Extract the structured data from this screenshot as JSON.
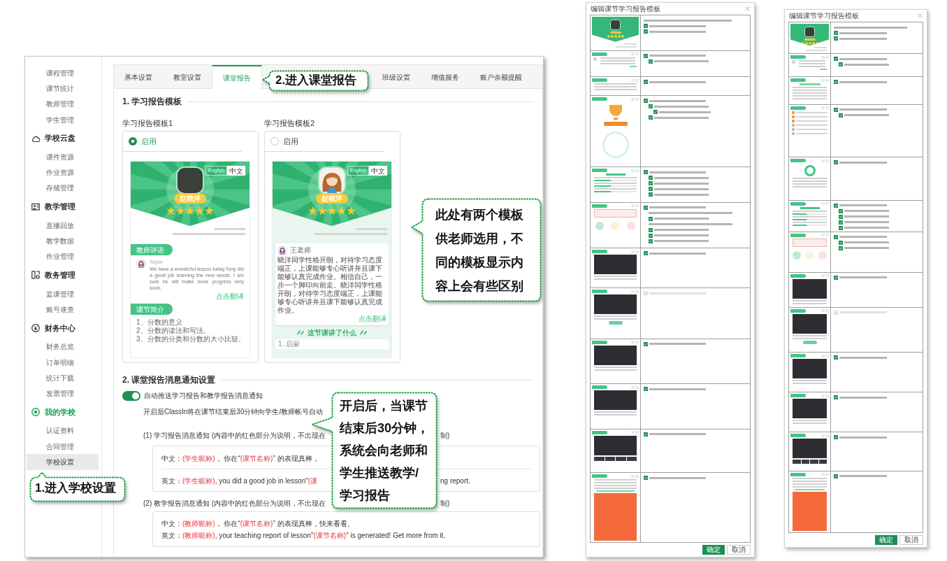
{
  "sidebar": {
    "groups": [
      {
        "items": [
          {
            "label": "课程管理",
            "selected": false
          },
          {
            "label": "课节统计",
            "selected": false
          },
          {
            "label": "教师管理",
            "selected": false
          },
          {
            "label": "学生管理",
            "selected": false
          }
        ]
      },
      {
        "title": "学校云盘",
        "active": false,
        "items": [
          {
            "label": "课件资源",
            "selected": false
          },
          {
            "label": "作业资源",
            "selected": false
          },
          {
            "label": "存储管理",
            "selected": false
          }
        ]
      },
      {
        "title": "教学管理",
        "active": false,
        "items": [
          {
            "label": "直播回放",
            "selected": false
          },
          {
            "label": "教学数据",
            "selected": false
          },
          {
            "label": "作业管理",
            "selected": false
          }
        ]
      },
      {
        "title": "教务管理",
        "active": false,
        "items": [
          {
            "label": "监课管理",
            "selected": false
          },
          {
            "label": "账号速查",
            "selected": false
          }
        ]
      },
      {
        "title": "财务中心",
        "active": false,
        "items": [
          {
            "label": "财务总览",
            "selected": false
          },
          {
            "label": "订单明细",
            "selected": false
          },
          {
            "label": "统计下载",
            "selected": false
          },
          {
            "label": "发票管理",
            "selected": false
          }
        ]
      },
      {
        "title": "我的学校",
        "active": true,
        "items": [
          {
            "label": "认证资料",
            "selected": false
          },
          {
            "label": "合同管理",
            "selected": false
          },
          {
            "label": "学校设置",
            "selected": true
          }
        ]
      }
    ]
  },
  "tabs": [
    {
      "label": "基本设置",
      "selected": false
    },
    {
      "label": "教室设置",
      "selected": false
    },
    {
      "label": "课堂报告",
      "selected": true
    },
    {
      "label": "班级设置",
      "selected": false
    },
    {
      "label": "增值服务",
      "selected": false
    },
    {
      "label": "账户余额提醒",
      "selected": false
    }
  ],
  "templates": {
    "heading": "1. 学习报告模板",
    "items": [
      {
        "label": "学习报告模板1",
        "option": "启用",
        "selected": true,
        "preview": {
          "kind": "plain",
          "lang_toggle": [
            {
              "label": "English",
              "selected": false
            },
            {
              "label": "中文",
              "selected": true
            }
          ],
          "avatar": {
            "kind": "photo"
          },
          "name": "赵晓洋",
          "stars": 5,
          "sections": [
            {
              "kind": "comment",
              "tag": "教师评语",
              "author": "Taylor",
              "text": "We have a wonderful lesson today.Tony did a great job learning the new words. I am sure he will make more progress very soon.",
              "link": "点击翻译"
            },
            {
              "kind": "list",
              "tag": "课节简介",
              "items": [
                "1、分数的意义",
                "2、分数的读法和写法。",
                "3、分数的分类和分数的大小比较。"
              ]
            }
          ]
        }
      },
      {
        "label": "学习报告模板2",
        "option": "启用",
        "selected": false,
        "preview": {
          "kind": "cards",
          "lang_toggle": [
            {
              "label": "English",
              "selected": false
            },
            {
              "label": "中文",
              "selected": true
            }
          ],
          "avatar": {
            "kind": "cartoon"
          },
          "name": "赵晓洋",
          "stars": 5,
          "sections": [
            {
              "kind": "card_comment",
              "author": "王老师",
              "text": "晓洋同学性格开朗，对待学习态度端正，上课能够专心听讲并且课下能够认真完成作业。相信自己，一步一个脚印向前走。晓洋同学性格开朗，对待学习态度端正，上课能够专心听讲并且课下能够认真完成作业。",
              "link": "点击翻译"
            },
            {
              "kind": "heading",
              "text": "这节课讲了什么"
            },
            {
              "kind": "list_card",
              "items": [
                "1. 启蒙"
              ]
            }
          ]
        }
      }
    ]
  },
  "notifications": {
    "heading": "2. 课堂报告消息通知设置",
    "toggle": {
      "label": "自动推送学习报告和教学报告消息通知",
      "on": true
    },
    "description": "开启后ClassIn将在课节结束后30分钟向学生/教师帐号自动",
    "messages": [
      {
        "title": "(1) 学习报告消息通知 (内容中的红色部分为说明，不出现在",
        "title_after": "制)",
        "divided": true,
        "lines": [
          {
            "segments": [
              {
                "text": "中文：",
                "highlight": false
              },
              {
                "text": "(学生昵称)",
                "highlight": true
              },
              {
                "text": "， 你在“",
                "highlight": false
              },
              {
                "text": "(课节名称)",
                "highlight": true
              },
              {
                "text": "” 的表现真棒，",
                "highlight": false
              }
            ]
          },
          {
            "segments": [
              {
                "text": "英文：",
                "highlight": false
              },
              {
                "text": "(学生昵称)",
                "highlight": true
              },
              {
                "text": ", you did a good job in lesson\"",
                "highlight": false
              },
              {
                "text": "(课",
                "highlight": true
              }
            ],
            "after": "ng report."
          }
        ]
      },
      {
        "title": "(2) 教学报告消息通知 (内容中的红色部分为说明，不出现在",
        "title_after": "制)",
        "divided": false,
        "lines": [
          {
            "segments": [
              {
                "text": "中文：",
                "highlight": false
              },
              {
                "text": "(教师昵称)",
                "highlight": true
              },
              {
                "text": "， 你在“",
                "highlight": false
              },
              {
                "text": "(课节名称)",
                "highlight": true
              },
              {
                "text": "” 的表现真棒，快来看看。",
                "highlight": false
              }
            ]
          },
          {
            "segments": [
              {
                "text": "英文：",
                "highlight": false
              },
              {
                "text": "(教师昵称)",
                "highlight": true
              },
              {
                "text": ", your teaching report of lesson\"",
                "highlight": false
              },
              {
                "text": "(课节名称)",
                "highlight": true
              },
              {
                "text": "\" is generated! Get more from it.",
                "highlight": false
              }
            ]
          }
        ]
      }
    ]
  },
  "callouts": [
    {
      "text": "1.进入学校设置"
    },
    {
      "text": "2.进入课堂报告"
    },
    {
      "text": "此处有两个模板供老师选用，不同的模板显示内容上会有些区别"
    },
    {
      "text": "开启后，当课节结束后30分钟，系统会向老师和学生推送教学/学习报告"
    }
  ],
  "dialogs": [
    {
      "title": "编辑课节学习报告模板",
      "rows": [
        {
          "kind": "banner",
          "options": [
            {
              "kind": "note"
            },
            {
              "kind": "check",
              "checked": true,
              "disabled": false
            },
            {
              "kind": "check",
              "checked": true,
              "disabled": false
            }
          ]
        },
        {
          "kind": "comment",
          "options": [
            {
              "kind": "check",
              "checked": true,
              "disabled": false,
              "children": [
                {
                  "kind": "check",
                  "checked": true,
                  "disabled": false
                }
              ]
            }
          ]
        },
        {
          "kind": "list",
          "options": [
            {
              "kind": "check",
              "checked": true,
              "disabled": false
            }
          ]
        },
        {
          "kind": "trophy",
          "options": [
            {
              "kind": "check",
              "checked": true,
              "disabled": false,
              "children": [
                {
                  "kind": "check",
                  "checked": true,
                  "disabled": false,
                  "children": [
                    {
                      "kind": "check",
                      "checked": true,
                      "disabled": false
                    }
                  ]
                },
                {
                  "kind": "check",
                  "checked": true,
                  "disabled": false
                }
              ]
            }
          ]
        },
        {
          "kind": "activity",
          "options": [
            {
              "kind": "check",
              "checked": true,
              "disabled": false,
              "children": [
                {
                  "kind": "check",
                  "checked": true,
                  "disabled": false
                },
                {
                  "kind": "check",
                  "checked": true,
                  "disabled": false
                },
                {
                  "kind": "check",
                  "checked": true,
                  "disabled": false
                },
                {
                  "kind": "check",
                  "checked": true,
                  "disabled": false
                }
              ]
            }
          ]
        },
        {
          "kind": "attendance",
          "options": [
            {
              "kind": "check",
              "checked": true,
              "disabled": false,
              "children": [
                {
                  "kind": "note"
                },
                {
                  "kind": "check",
                  "checked": true,
                  "disabled": false
                },
                {
                  "kind": "note"
                },
                {
                  "kind": "check",
                  "checked": true,
                  "disabled": false
                },
                {
                  "kind": "check",
                  "checked": true,
                  "disabled": false
                },
                {
                  "kind": "check",
                  "checked": true,
                  "disabled": false
                }
              ]
            }
          ]
        },
        {
          "kind": "board",
          "options": [
            {
              "kind": "check",
              "checked": true,
              "disabled": false
            }
          ]
        },
        {
          "kind": "notes",
          "options": [
            {
              "kind": "check",
              "checked": true,
              "disabled": true
            }
          ]
        },
        {
          "kind": "dark",
          "options": [
            {
              "kind": "check",
              "checked": true,
              "disabled": false
            }
          ]
        },
        {
          "kind": "dark",
          "options": [
            {
              "kind": "check",
              "checked": true,
              "disabled": false
            }
          ]
        },
        {
          "kind": "gallery",
          "options": [
            {
              "kind": "check",
              "checked": true,
              "disabled": false
            }
          ]
        },
        {
          "kind": "promo",
          "options": [
            {
              "kind": "check",
              "checked": true,
              "disabled": false
            }
          ]
        }
      ],
      "buttons": [
        {
          "label": "确定",
          "kind": "primary"
        },
        {
          "label": "取消",
          "kind": "secondary"
        }
      ]
    },
    {
      "title": "编辑课节学习报告模板",
      "rows": [
        {
          "kind": "banner",
          "options": [
            {
              "kind": "note"
            },
            {
              "kind": "check",
              "checked": true,
              "disabled": false
            },
            {
              "kind": "check",
              "checked": true,
              "disabled": false
            }
          ]
        },
        {
          "kind": "comment",
          "options": [
            {
              "kind": "check",
              "checked": true,
              "disabled": false,
              "children": [
                {
                  "kind": "check",
                  "checked": true,
                  "disabled": false
                }
              ]
            }
          ]
        },
        {
          "kind": "titled_list",
          "options": [
            {
              "kind": "check",
              "checked": true,
              "disabled": false
            }
          ]
        },
        {
          "kind": "ranking",
          "options": [
            {
              "kind": "check",
              "checked": true,
              "disabled": false,
              "children": [
                {
                  "kind": "check",
                  "checked": true,
                  "disabled": false
                }
              ]
            }
          ]
        },
        {
          "kind": "ring",
          "options": [
            {
              "kind": "check",
              "checked": true,
              "disabled": false
            }
          ]
        },
        {
          "kind": "activity",
          "options": [
            {
              "kind": "check",
              "checked": true,
              "disabled": false,
              "children": [
                {
                  "kind": "check",
                  "checked": true,
                  "disabled": false
                },
                {
                  "kind": "check",
                  "checked": true,
                  "disabled": false
                },
                {
                  "kind": "check",
                  "checked": true,
                  "disabled": false
                },
                {
                  "kind": "check",
                  "checked": true,
                  "disabled": false
                }
              ]
            }
          ]
        },
        {
          "kind": "attendance",
          "options": [
            {
              "kind": "check",
              "checked": true,
              "disabled": false,
              "children": [
                {
                  "kind": "check",
                  "checked": true,
                  "disabled": false
                },
                {
                  "kind": "check",
                  "checked": true,
                  "disabled": false
                }
              ]
            }
          ]
        },
        {
          "kind": "board",
          "options": [
            {
              "kind": "check",
              "checked": true,
              "disabled": false
            }
          ]
        },
        {
          "kind": "notes",
          "options": [
            {
              "kind": "check",
              "checked": true,
              "disabled": true
            }
          ]
        },
        {
          "kind": "dark",
          "options": [
            {
              "kind": "check",
              "checked": true,
              "disabled": false
            }
          ]
        },
        {
          "kind": "dark",
          "options": [
            {
              "kind": "check",
              "checked": true,
              "disabled": false
            }
          ]
        },
        {
          "kind": "gallery",
          "options": [
            {
              "kind": "check",
              "checked": true,
              "disabled": false
            }
          ]
        },
        {
          "kind": "promo",
          "options": [
            {
              "kind": "check",
              "checked": true,
              "disabled": false
            }
          ]
        }
      ],
      "buttons": [
        {
          "label": "确定",
          "kind": "primary"
        },
        {
          "label": "取消",
          "kind": "secondary"
        }
      ]
    }
  ]
}
